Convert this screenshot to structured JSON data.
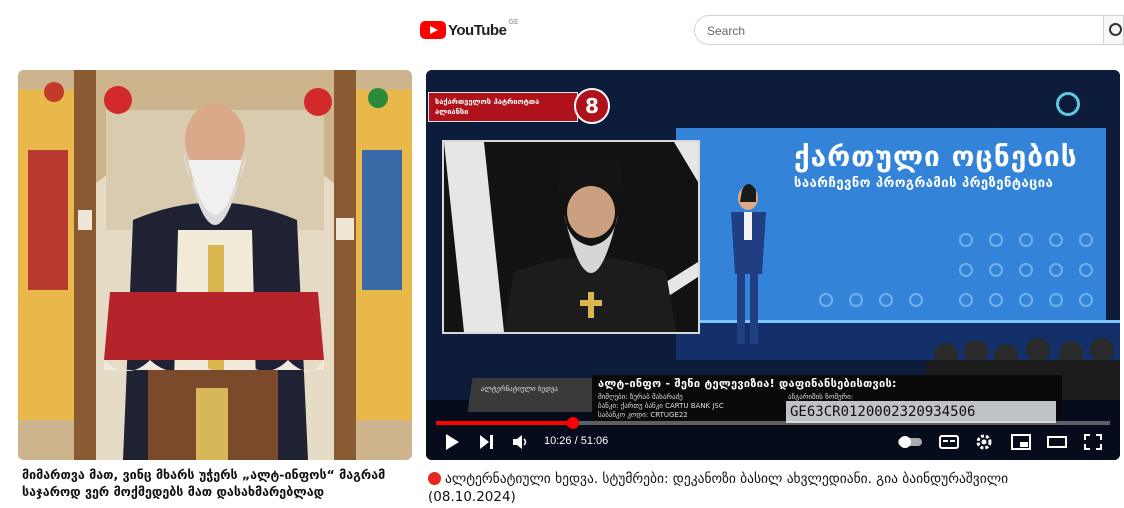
{
  "left_panel": {
    "caption": "მიმართვა მათ, ვინც მხარს უჭერს „ალტ-ინფოს“ მაგრამ საჯაროდ ვერ მოქმედებს მათ დასახმარებლად"
  },
  "youtube": {
    "logo_text": "YouTube",
    "country_code": "GE",
    "search_placeholder": "Search"
  },
  "player": {
    "channel_label": "საქართველოს პატრიოტთა ალიანსი",
    "channel_number": "8",
    "stage_title": "ქართული ოცნების",
    "stage_subtitle": "საარჩევნო პროგრამის პრეზენტაცია",
    "lower_tag": "ალტერნატიული ხედვა",
    "donation_heading": "ალტ-ინფო - შენი ტელევიზია! დაფინანსებისთვის:",
    "bank_lines": [
      "მიმღები: ზურაბ მახარაძე",
      "ბანკი: ქართუ ბანკი CARTU BANK JSC",
      "საბანკო კოდი: CRTUGE22"
    ],
    "iban_label": "ანგარიშის ნომერი:",
    "iban": "GE63CR0120002320934506",
    "time_current": "10:26",
    "time_separator": " / ",
    "time_total": "51:06",
    "progress": 0.204,
    "accent_color": "#ff0000"
  },
  "video": {
    "title": "ალტერნატიული ხედვა. სტუმრები: დეკანოზი ბასილ ახვლედიანი. გია ბაინდურაშვილი (08.10.2024)"
  }
}
